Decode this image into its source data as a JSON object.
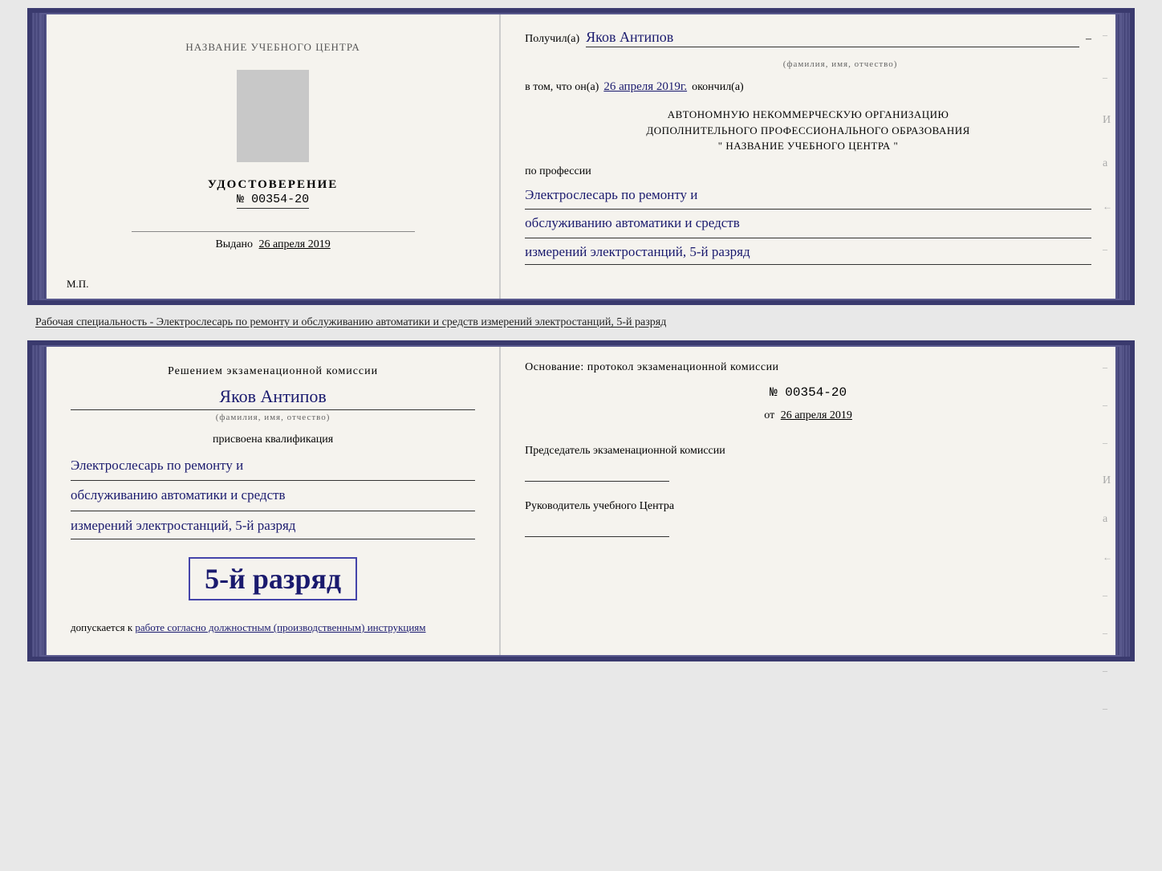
{
  "top_left": {
    "center_title": "НАЗВАНИЕ УЧЕБНОГО ЦЕНТРА",
    "udost_label": "УДОСТОВЕРЕНИЕ",
    "number": "№ 00354-20",
    "vydano_label": "Выдано",
    "vydano_date": "26 апреля 2019",
    "mp_label": "М.П."
  },
  "top_right": {
    "poluchil_label": "Получил(а)",
    "recipient_name": "Яков Антипов",
    "fio_subtitle": "(фамилия, имя, отчество)",
    "vtom_label": "в том, что он(а)",
    "vtom_date": "26 апреля 2019г.",
    "okonchil_label": "окончил(а)",
    "org_line1": "АВТОНОМНУЮ НЕКОММЕРЧЕСКУЮ ОРГАНИЗАЦИЮ",
    "org_line2": "ДОПОЛНИТЕЛЬНОГО ПРОФЕССИОНАЛЬНОГО ОБРАЗОВАНИЯ",
    "org_line3": "\"  НАЗВАНИЕ УЧЕБНОГО ЦЕНТРА  \"",
    "po_professii": "по профессии",
    "profession_line1": "Электрослесарь по ремонту и",
    "profession_line2": "обслуживанию автоматики и средств",
    "profession_line3": "измерений электростанций, 5-й разряд",
    "side_labels": [
      "И",
      "а",
      "←",
      "—"
    ]
  },
  "between": {
    "specialty_text": "Рабочая специальность - Электрослесарь по ремонту и обслуживанию автоматики и средств измерений электростанций, 5-й разряд"
  },
  "bottom_left": {
    "resheniem_title": "Решением экзаменационной комиссии",
    "person_name": "Яков Антипов",
    "fio_subtitle": "(фамилия, имя, отчество)",
    "prisvoena": "присвоена квалификация",
    "qual_line1": "Электрослесарь по ремонту и",
    "qual_line2": "обслуживанию автоматики и средств",
    "qual_line3": "измерений электростанций, 5-й разряд",
    "razryad_big": "5-й разряд",
    "dopuskaetsya_label": "допускается к",
    "dopuskaetsya_italic": "работе согласно должностным (производственным) инструкциям"
  },
  "bottom_right": {
    "osnovanie": "Основание: протокол экзаменационной комиссии",
    "protocol_number": "№ 00354-20",
    "ot_label": "от",
    "ot_date": "26 апреля 2019",
    "chairman_label": "Председатель экзаменационной комиссии",
    "director_label": "Руководитель учебного Центра",
    "side_labels": [
      "—",
      "—",
      "—",
      "И",
      "а",
      "←",
      "—",
      "—",
      "—",
      "—"
    ]
  }
}
